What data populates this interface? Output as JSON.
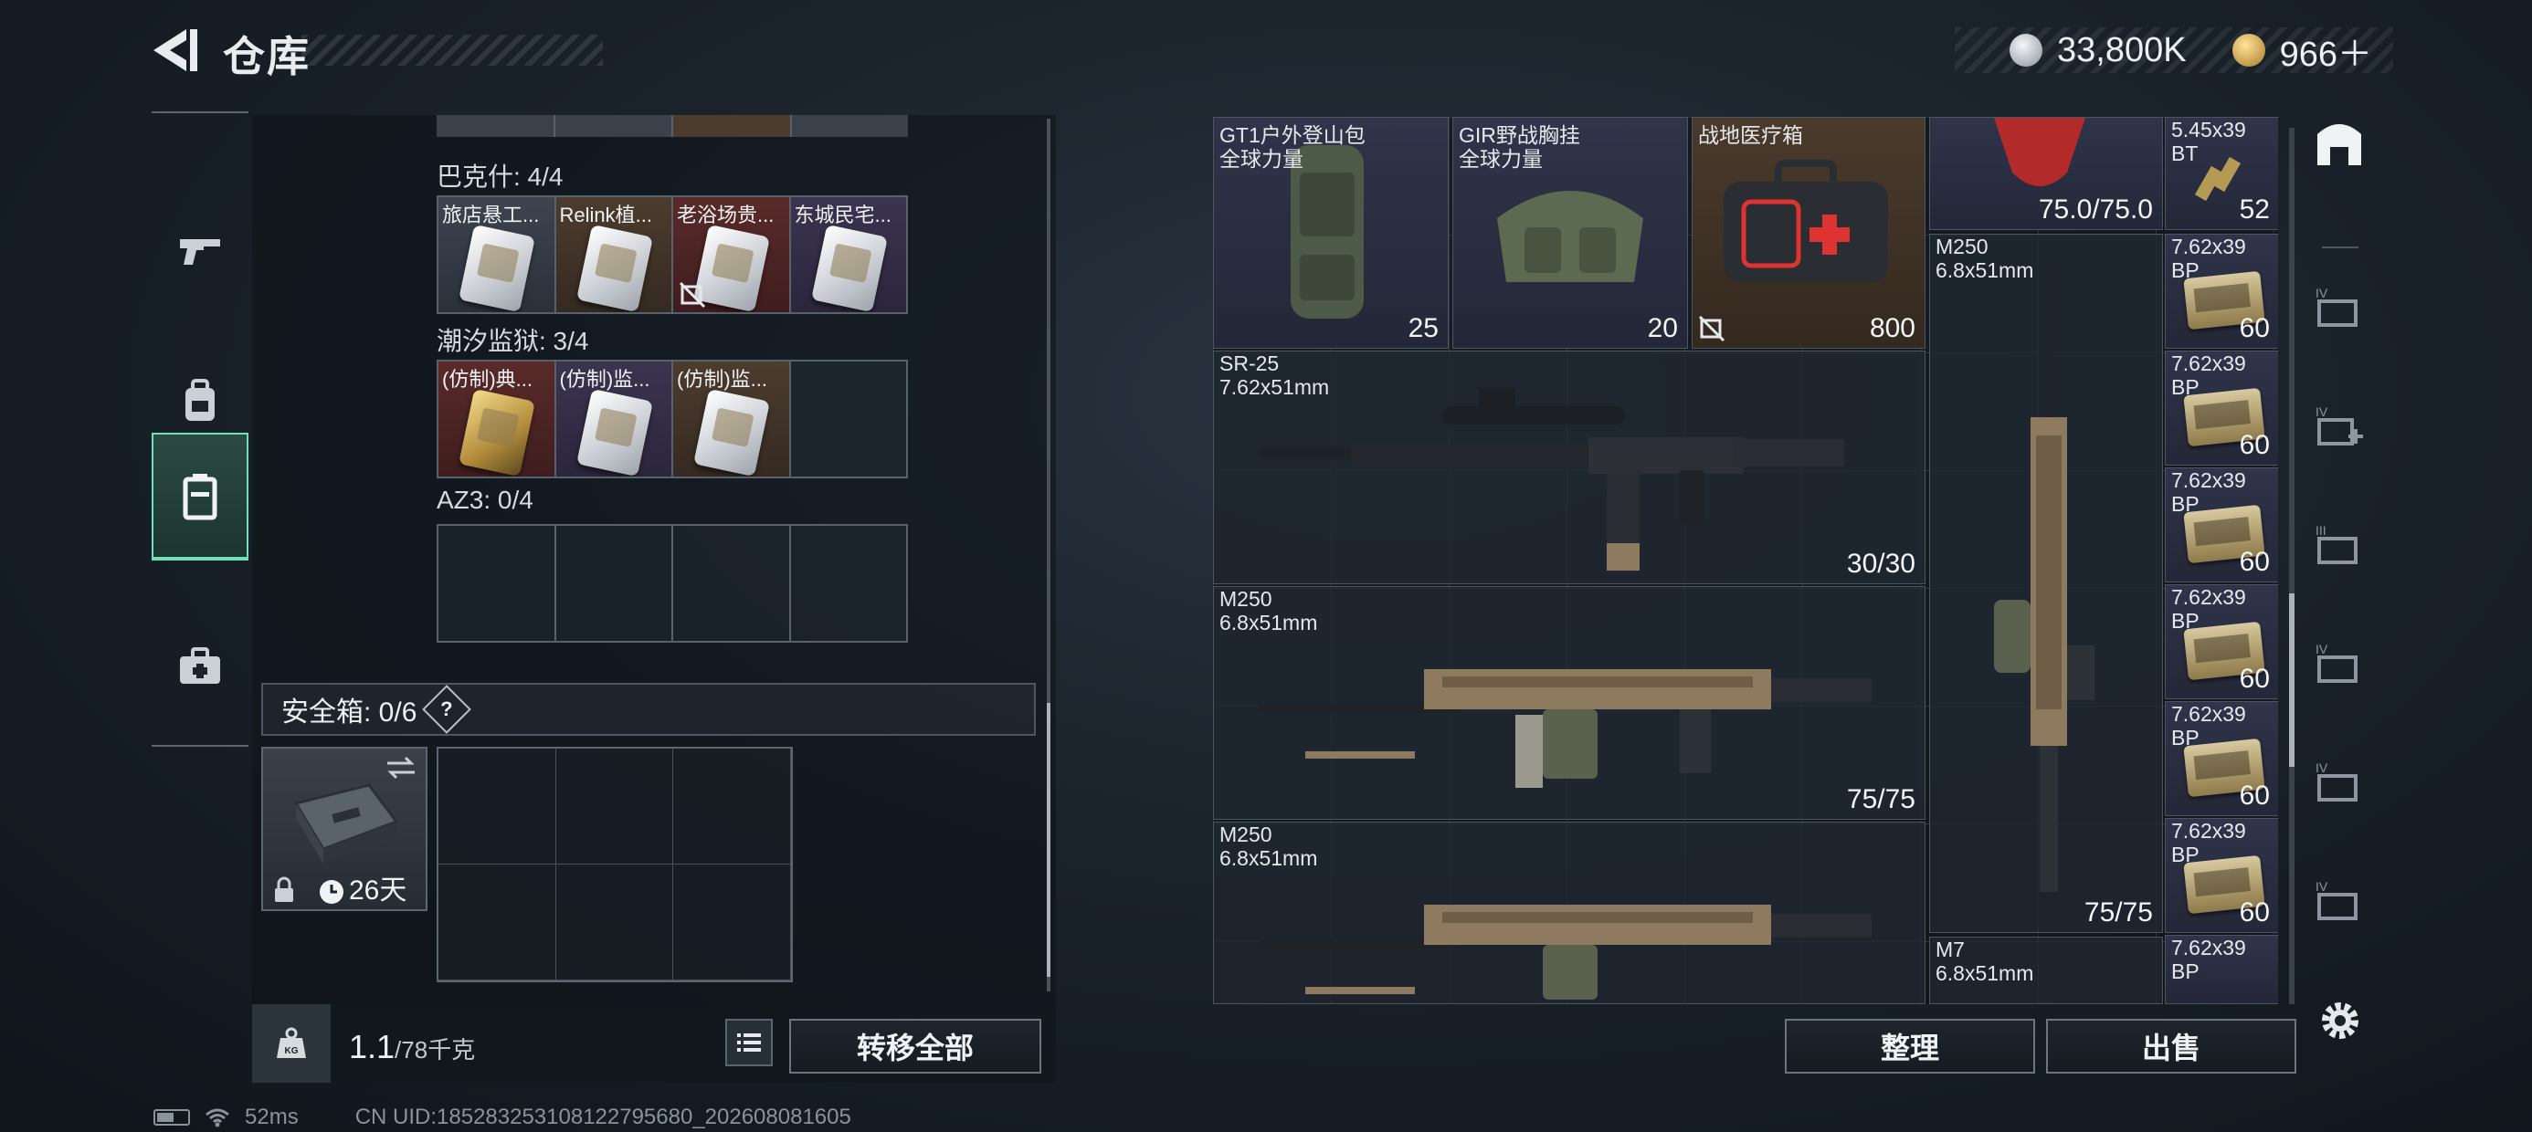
{
  "header": {
    "title": "仓库",
    "currency": [
      {
        "icon": "silver-coin-icon",
        "amount": "33,800K"
      },
      {
        "icon": "gold-coin-icon",
        "amount": "966＋"
      }
    ]
  },
  "left_nav": [
    {
      "icon": "gun-icon",
      "active": false
    },
    {
      "icon": "backpack-icon",
      "active": false
    },
    {
      "icon": "container-icon",
      "active": true
    },
    {
      "icon": "medkit-icon",
      "active": false
    }
  ],
  "groups": [
    {
      "label": "巴克什: 4/4",
      "slots": [
        {
          "name": "旅店悬工...",
          "rarity": "gray",
          "nosell": false
        },
        {
          "name": "Relink植...",
          "rarity": "brown",
          "nosell": false
        },
        {
          "name": "老浴场贵...",
          "rarity": "red",
          "nosell": true
        },
        {
          "name": "东城民宅...",
          "rarity": "purple",
          "nosell": false
        }
      ]
    },
    {
      "label": "潮汐监狱: 3/4",
      "slots": [
        {
          "name": "(仿制)典...",
          "rarity": "red",
          "card": "gold"
        },
        {
          "name": "(仿制)监...",
          "rarity": "purple",
          "card": "white"
        },
        {
          "name": "(仿制)监...",
          "rarity": "brown",
          "card": "white"
        },
        {
          "name": "",
          "rarity": "empty"
        }
      ]
    },
    {
      "label": "AZ3: 0/4",
      "slots": []
    }
  ],
  "safe": {
    "label": "安全箱: 0/6",
    "help": "?",
    "timer": "26天"
  },
  "footer_left": {
    "weight_value": "1.1",
    "weight_max": "/78千克",
    "kg_label": "KG",
    "transfer_all": "转移全部"
  },
  "inventory": {
    "backpack": {
      "name1": "GT1户外登山包",
      "name2": "全球力量",
      "count": "25"
    },
    "vest": {
      "name1": "GIR野战胸挂",
      "name2": "全球力量",
      "count": "20"
    },
    "medkit": {
      "name1": "战地医疗箱",
      "count": "800"
    },
    "helmet_count": "75.0/75.0",
    "ammo_top": {
      "name": "5.45x39",
      "sub": "BT",
      "count": "52"
    },
    "sr25": {
      "name1": "SR-25",
      "name2": "7.62x51mm",
      "ammo": "30/30"
    },
    "m250_a": {
      "name1": "M250",
      "name2": "6.8x51mm",
      "ammo": "75/75"
    },
    "m250_b": {
      "name1": "M250",
      "name2": "6.8x51mm"
    },
    "m250_vert": {
      "name1": "M250",
      "name2": "6.8x51mm",
      "ammo": "75/75"
    },
    "m7": {
      "name1": "M7",
      "name2": "6.8x51mm"
    },
    "ammo_list": [
      {
        "name": "7.62x39",
        "sub": "BP",
        "count": "60"
      },
      {
        "name": "7.62x39",
        "sub": "BP",
        "count": "60"
      },
      {
        "name": "7.62x39",
        "sub": "BP",
        "count": "60"
      },
      {
        "name": "7.62x39",
        "sub": "BP",
        "count": "60"
      },
      {
        "name": "7.62x39",
        "sub": "BP",
        "count": "60"
      },
      {
        "name": "7.62x39",
        "sub": "BP",
        "count": "60"
      },
      {
        "name": "7.62x39",
        "sub": "BP",
        "count": ""
      }
    ]
  },
  "right_nav": [
    "warehouse-icon",
    "storage-IV-icon",
    "storage-IV-add-icon",
    "storage-III-icon",
    "storage-IV-b-icon",
    "storage-IV-c-icon",
    "storage-IV-d-icon"
  ],
  "footer_right": {
    "sort": "整理",
    "sell": "出售"
  },
  "status": {
    "ping": "52ms",
    "uid": "CN UID:1852832531081227956​80_202608081605"
  }
}
